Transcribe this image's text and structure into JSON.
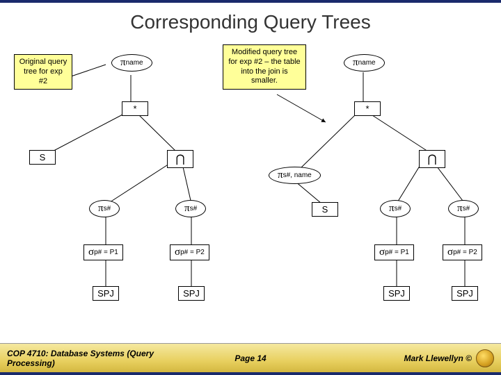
{
  "title": "Corresponding Query Trees",
  "labels": {
    "original": "Original query tree for exp #2",
    "modified": "Modified query tree for exp #2 – the table into the join is smaller."
  },
  "symbols": {
    "pi": "π",
    "sigma": "σ",
    "star": "*",
    "intersect": "⋂"
  },
  "tree": {
    "pi_name": "name",
    "pi_sname": "s#, name",
    "pi_s": "s#",
    "sig_p1": "p# = P1",
    "sig_p2": "p# = P2",
    "leaf_spj": "SPJ",
    "rel_s": "S"
  },
  "footer": {
    "left": "COP 4710: Database Systems (Query Processing)",
    "mid": "Page 14",
    "right": "Mark Llewellyn ©"
  }
}
